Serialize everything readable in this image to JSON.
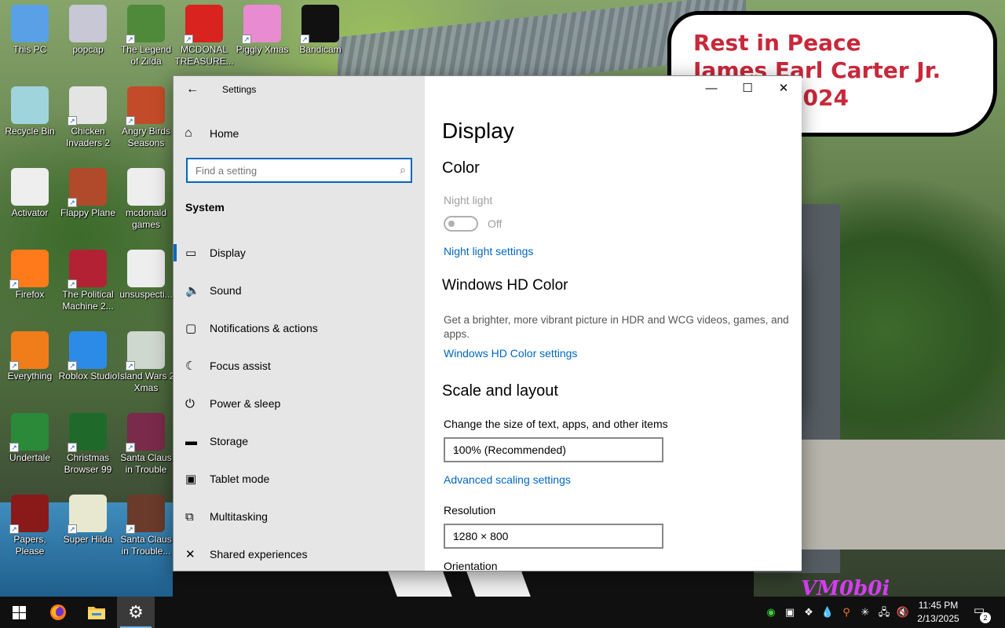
{
  "wallpaper": {
    "message_lines": [
      "Rest in Peace",
      "James Earl Carter Jr.",
      "2024"
    ],
    "watermark": "VM0b0i"
  },
  "desktop_icons": [
    {
      "label": "This PC",
      "shortcut": false,
      "color": "#5aa0e6"
    },
    {
      "label": "popcap",
      "shortcut": false,
      "color": "#c7c7d6"
    },
    {
      "label": "The Legend of Zilda",
      "shortcut": true,
      "color": "#4e8a3a"
    },
    {
      "label": "MCDONAL TREASURE...",
      "shortcut": true,
      "color": "#d8231f"
    },
    {
      "label": "Piggly Xmas",
      "shortcut": true,
      "color": "#e88bd0"
    },
    {
      "label": "Bandicam",
      "shortcut": true,
      "color": "#111111"
    },
    {
      "label": "Recycle Bin",
      "shortcut": false,
      "color": "#9fd4dc"
    },
    {
      "label": "Chicken Invaders 2",
      "shortcut": true,
      "color": "#e4e4e4"
    },
    {
      "label": "Angry Birds Seasons",
      "shortcut": true,
      "color": "#c44b2a"
    },
    {
      "label": "Activator",
      "shortcut": false,
      "color": "#eeeeee"
    },
    {
      "label": "Flappy Plane",
      "shortcut": true,
      "color": "#b04a2a"
    },
    {
      "label": "mcdonald games",
      "shortcut": false,
      "color": "#eeeeee"
    },
    {
      "label": "Firefox",
      "shortcut": true,
      "color": "#ff7a1a"
    },
    {
      "label": "The Political Machine 2...",
      "shortcut": true,
      "color": "#b22234"
    },
    {
      "label": "unsuspecti...",
      "shortcut": false,
      "color": "#eeeeee"
    },
    {
      "label": "Everything",
      "shortcut": true,
      "color": "#f07c1a"
    },
    {
      "label": "Roblox Studio",
      "shortcut": true,
      "color": "#2d8be8"
    },
    {
      "label": "Island Wars 2 Xmas",
      "shortcut": true,
      "color": "#cfd8cf"
    },
    {
      "label": "Undertale",
      "shortcut": true,
      "color": "#2a8a3a"
    },
    {
      "label": "Christmas Browser 99",
      "shortcut": true,
      "color": "#1f6a2a"
    },
    {
      "label": "Santa Claus in Trouble",
      "shortcut": true,
      "color": "#7a2a4a"
    },
    {
      "label": "Papers, Please",
      "shortcut": true,
      "color": "#8a1a1a"
    },
    {
      "label": "Super Hilda",
      "shortcut": true,
      "color": "#e8e8d0"
    },
    {
      "label": "Santa Claus in Trouble...",
      "shortcut": true,
      "color": "#6a3a2a"
    }
  ],
  "settings": {
    "window_title": "Settings",
    "back_glyph": "←",
    "controls": {
      "minimize": "—",
      "maximize": "☐",
      "close": "✕"
    },
    "nav": {
      "home_label": "Home",
      "search_placeholder": "Find a setting",
      "section_label": "System",
      "items": [
        {
          "label": "Display",
          "icon": "monitor-icon",
          "glyph": "▭",
          "selected": true
        },
        {
          "label": "Sound",
          "icon": "speaker-icon",
          "glyph": "🔈",
          "selected": false
        },
        {
          "label": "Notifications & actions",
          "icon": "notification-icon",
          "glyph": "▢",
          "selected": false
        },
        {
          "label": "Focus assist",
          "icon": "moon-icon",
          "glyph": "☾",
          "selected": false
        },
        {
          "label": "Power & sleep",
          "icon": "power-icon",
          "glyph": "⏻",
          "selected": false
        },
        {
          "label": "Storage",
          "icon": "storage-icon",
          "glyph": "▬",
          "selected": false
        },
        {
          "label": "Tablet mode",
          "icon": "tablet-icon",
          "glyph": "▣",
          "selected": false
        },
        {
          "label": "Multitasking",
          "icon": "multitasking-icon",
          "glyph": "⧉",
          "selected": false
        },
        {
          "label": "Shared experiences",
          "icon": "shared-experiences-icon",
          "glyph": "✕",
          "selected": false
        }
      ]
    },
    "content": {
      "page_title": "Display",
      "color_heading": "Color",
      "night_light_label": "Night light",
      "night_light_state": "Off",
      "night_light_link": "Night light settings",
      "hdr_heading": "Windows HD Color",
      "hdr_description": "Get a brighter, more vibrant picture in HDR and WCG videos, games, and apps.",
      "hdr_link": "Windows HD Color settings",
      "scale_heading": "Scale and layout",
      "scale_label": "Change the size of text, apps, and other items",
      "scale_value": "100% (Recommended)",
      "advanced_scaling_link": "Advanced scaling settings",
      "resolution_label": "Resolution",
      "resolution_value": "1280 × 800",
      "orientation_label": "Orientation"
    }
  },
  "taskbar": {
    "clock_time": "11:45 PM",
    "clock_date": "2/13/2025",
    "notification_count": "2",
    "accent": "#76b9ed"
  }
}
